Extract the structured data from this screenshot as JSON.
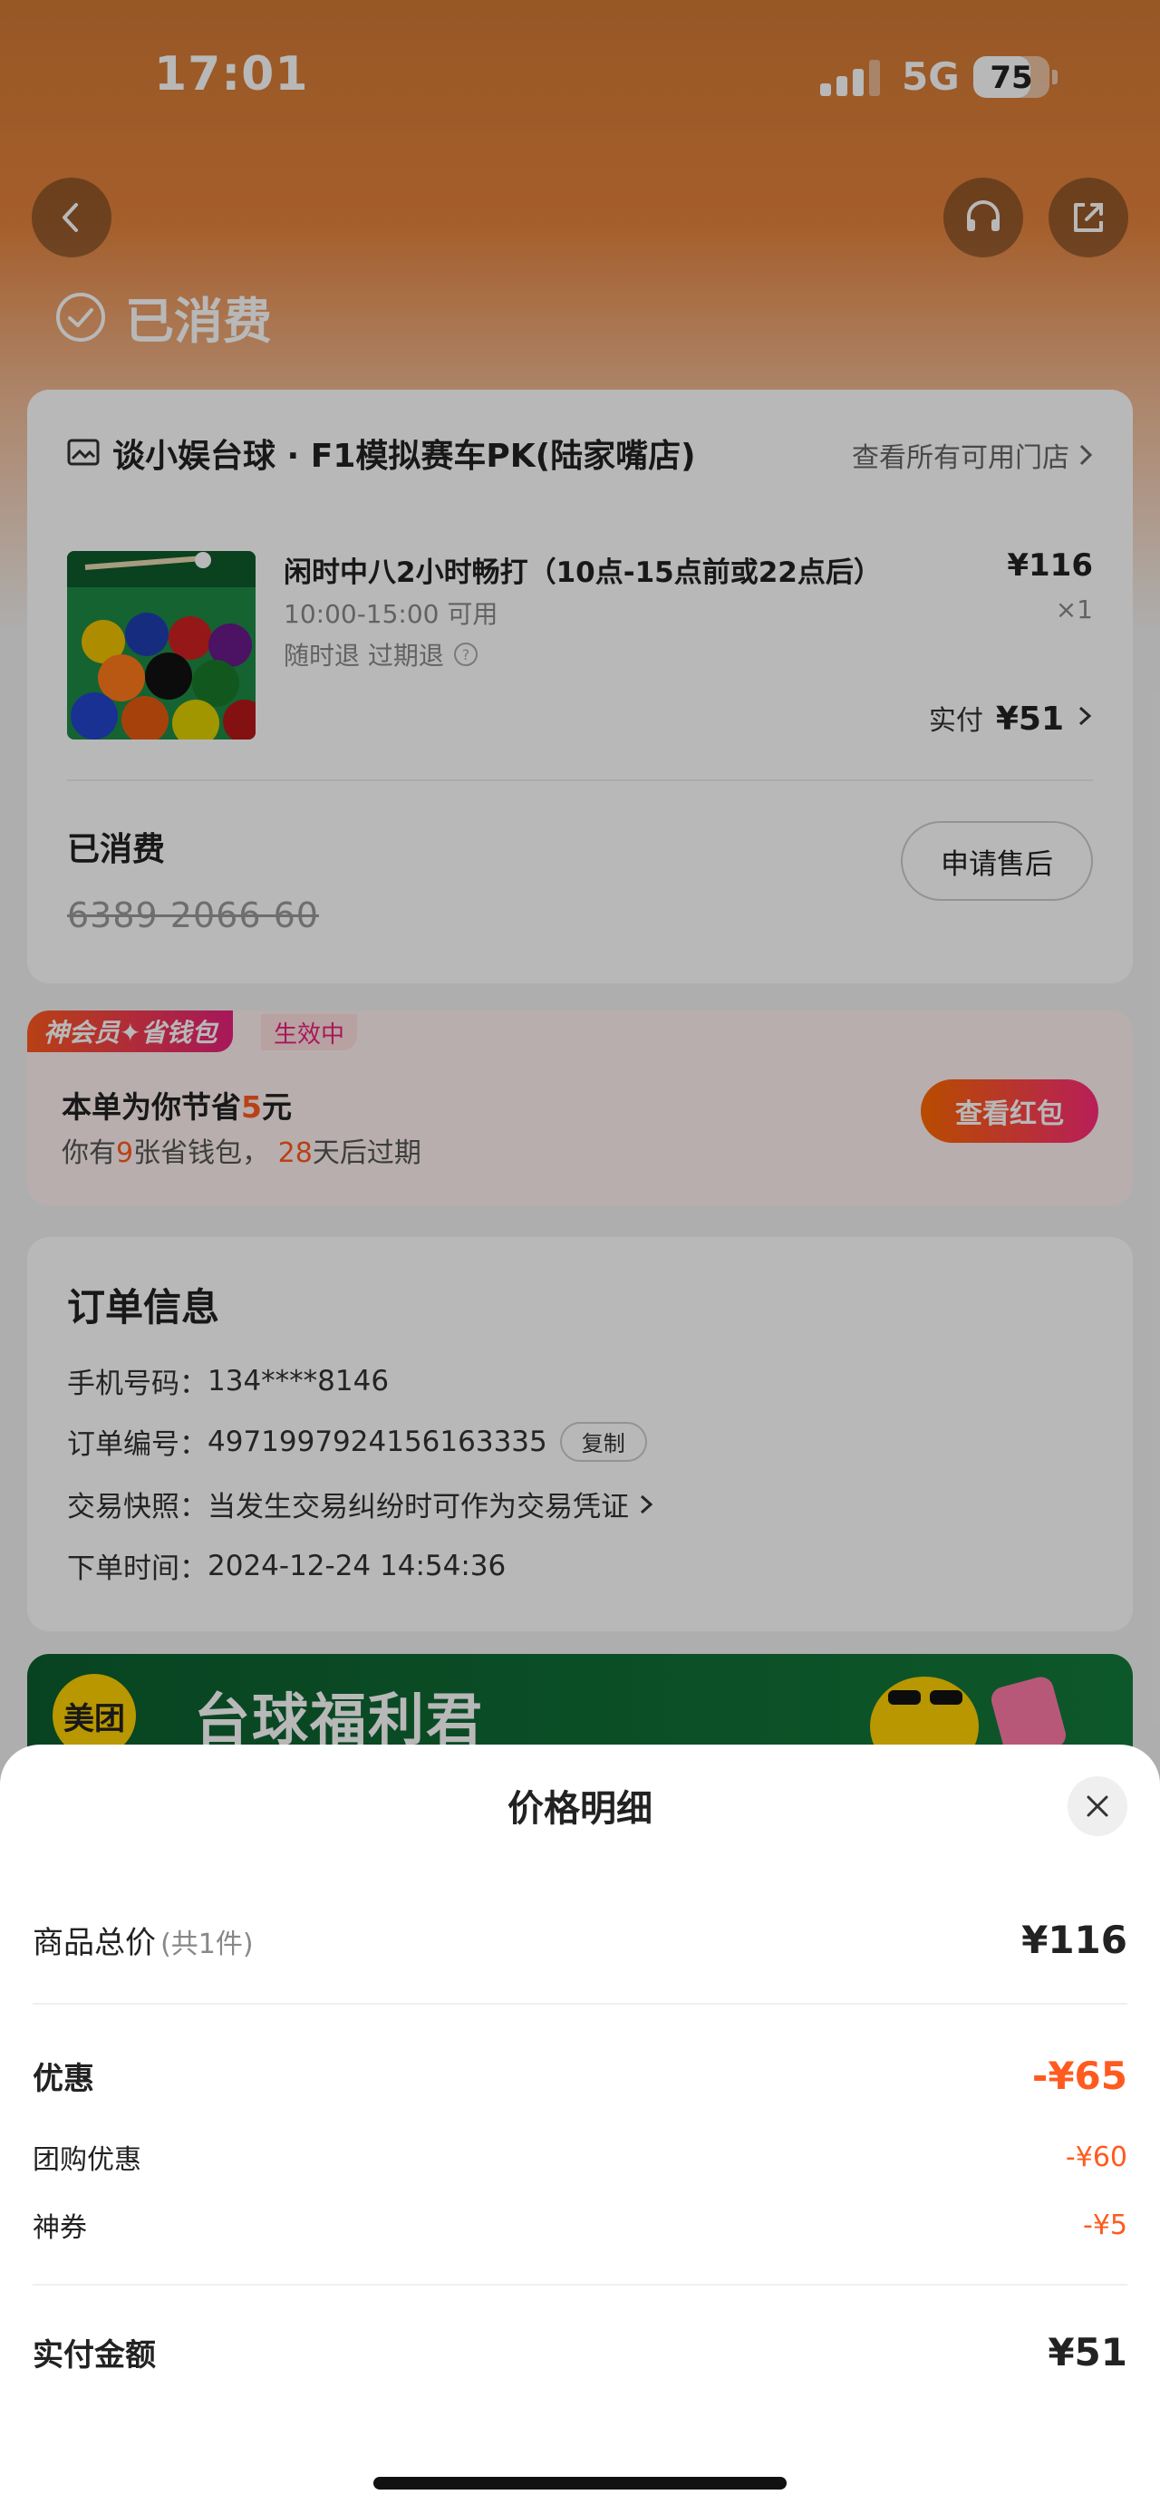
{
  "status_bar": {
    "time": "17:01",
    "network": "5G",
    "battery": "75",
    "battery_level": 0.75
  },
  "header": {
    "status_title": "已消费"
  },
  "store": {
    "name": "谈小娱台球 · F1模拟赛车PK(陆家嘴店)",
    "all_stores_link": "查看所有可用门店"
  },
  "product": {
    "title": "闲时中八2小时畅打（10点-15点前或22点后）",
    "time_window": "10:00-15:00 可用",
    "policy": "随时退 过期退",
    "price": "¥116",
    "qty": "×1",
    "paid_label": "实付",
    "paid_amount": "¥51"
  },
  "voucher": {
    "status": "已消费",
    "code": "6389 2066 60",
    "after_sale_button": "申请售后"
  },
  "member": {
    "tag": "神会员✦省钱包",
    "status": "生效中",
    "line1_prefix": "本单为你节省",
    "line1_amount": "5",
    "line1_suffix": "元",
    "line2_prefix": "你有",
    "line2_count": "9",
    "line2_mid": "张省钱包，",
    "line2_days": "28",
    "line2_suffix": "天后过期",
    "button": "查看红包"
  },
  "order": {
    "title": "订单信息",
    "phone_label": "手机号码：",
    "phone": "134****8146",
    "order_no_label": "订单编号：",
    "order_no": "4971997924156163335",
    "copy_button": "复制",
    "snapshot_label": "交易快照：",
    "snapshot_text": "当发生交易纠纷时可作为交易凭证",
    "time_label": "下单时间：",
    "time": "2024-12-24 14:54:36"
  },
  "banner": {
    "logo": "美团",
    "text": "台球福利君"
  },
  "price_sheet": {
    "title": "价格明细",
    "total_label": "商品总价",
    "total_note": "(共1件)",
    "total_value": "¥116",
    "discount_label": "优惠",
    "discount_value": "-¥65",
    "group_label": "团购优惠",
    "group_value": "-¥60",
    "coupon_label": "神券",
    "coupon_value": "-¥5",
    "paid_label": "实付金额",
    "paid_value": "¥51"
  },
  "colors": {
    "accent": "#ff5a1f",
    "hero": "#e5833c",
    "member_pink": "#e8217d"
  }
}
